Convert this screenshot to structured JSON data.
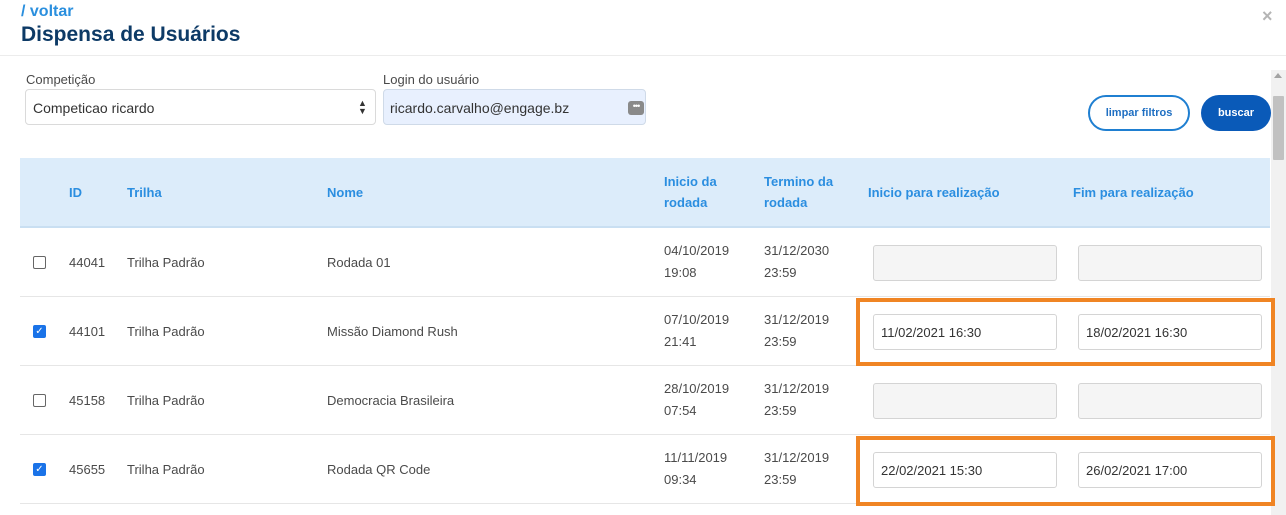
{
  "header": {
    "back_link": "/ voltar",
    "title": "Dispensa de Usuários",
    "close": "×"
  },
  "filters": {
    "competition_label": "Competição",
    "competition_value": "Competicao ricardo",
    "login_label": "Login do usuário",
    "login_value": "ricardo.carvalho@engage.bz",
    "clear_button": "limpar filtros",
    "search_button": "buscar"
  },
  "table": {
    "columns": {
      "id": "ID",
      "trail": "Trilha",
      "name": "Nome",
      "round_start": "Inicio da rodada",
      "round_end": "Termino da rodada",
      "exec_start": "Inicio para realização",
      "exec_end": "Fim para realização"
    },
    "rows": [
      {
        "checked": false,
        "id": "44041",
        "trail": "Trilha Padrão",
        "name": "Rodada 01",
        "round_start_date": "04/10/2019",
        "round_start_time": "19:08",
        "round_end_date": "31/12/2030",
        "round_end_time": "23:59",
        "exec_start": "",
        "exec_end": ""
      },
      {
        "checked": true,
        "id": "44101",
        "trail": "Trilha Padrão",
        "name": "Missão Diamond Rush",
        "round_start_date": "07/10/2019",
        "round_start_time": "21:41",
        "round_end_date": "31/12/2019",
        "round_end_time": "23:59",
        "exec_start": "11/02/2021 16:30",
        "exec_end": "18/02/2021 16:30"
      },
      {
        "checked": false,
        "id": "45158",
        "trail": "Trilha Padrão",
        "name": "Democracia Brasileira",
        "round_start_date": "28/10/2019",
        "round_start_time": "07:54",
        "round_end_date": "31/12/2019",
        "round_end_time": "23:59",
        "exec_start": "",
        "exec_end": ""
      },
      {
        "checked": true,
        "id": "45655",
        "trail": "Trilha Padrão",
        "name": "Rodada QR Code",
        "round_start_date": "11/11/2019",
        "round_start_time": "09:34",
        "round_end_date": "31/12/2019",
        "round_end_time": "23:59",
        "exec_start": "22/02/2021 15:30",
        "exec_end": "26/02/2021 17:00"
      }
    ]
  },
  "colors": {
    "accent": "#2a8fde",
    "title": "#0d3a66",
    "primary_button": "#0a5ab8",
    "header_bg": "#dcecfa",
    "highlight": "#f08524"
  }
}
